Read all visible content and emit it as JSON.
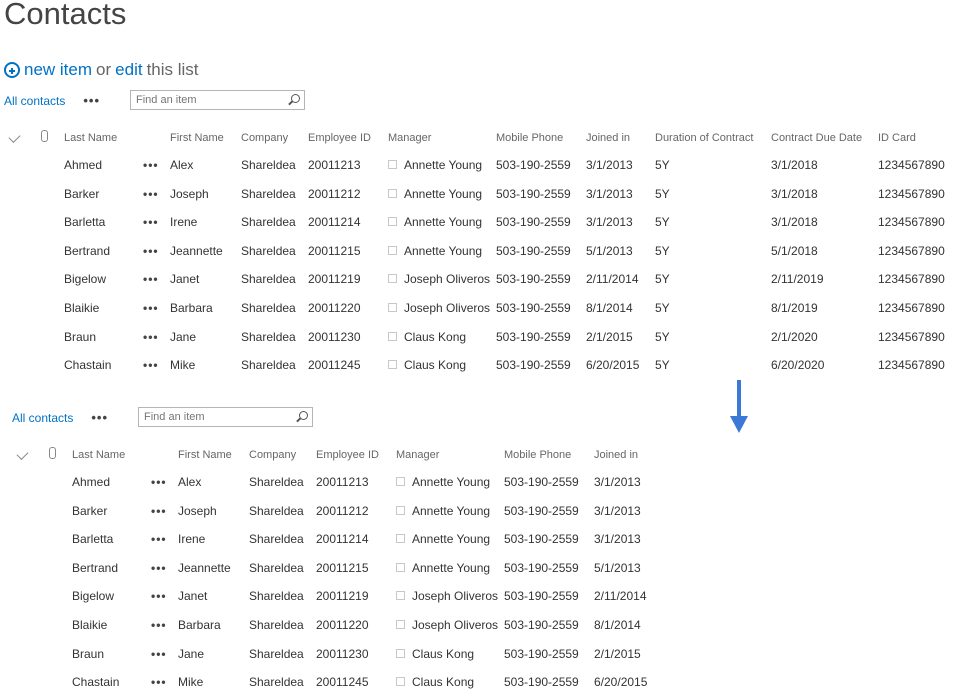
{
  "page_title": "Contacts",
  "new_item": {
    "new_label": "new item",
    "or_label": "or",
    "edit_label": "edit",
    "list_label": "this list"
  },
  "arrow": {
    "color": "#3c79d6"
  },
  "views": [
    {
      "view_name": "All contacts",
      "more_label": "•••",
      "search_placeholder": "Find an item",
      "headers": [
        "Last Name",
        "First Name",
        "Company",
        "Employee ID",
        "Manager",
        "Mobile Phone",
        "Joined in",
        "Duration of Contract",
        "Contract Due Date",
        "ID Card"
      ],
      "rows": [
        {
          "last": "Ahmed",
          "dots": "•••",
          "first": "Alex",
          "company": "Shareldea",
          "emp_id": "20011213",
          "manager": "Annette Young",
          "phone": "503-190-2559",
          "joined": "3/1/2013",
          "duration": "5Y",
          "due": "3/1/2018",
          "id_card": "1234567890"
        },
        {
          "last": "Barker",
          "dots": "•••",
          "first": "Joseph",
          "company": "Shareldea",
          "emp_id": "20011212",
          "manager": "Annette Young",
          "phone": "503-190-2559",
          "joined": "3/1/2013",
          "duration": "5Y",
          "due": "3/1/2018",
          "id_card": "1234567890"
        },
        {
          "last": "Barletta",
          "dots": "•••",
          "first": "Irene",
          "company": "Shareldea",
          "emp_id": "20011214",
          "manager": "Annette Young",
          "phone": "503-190-2559",
          "joined": "3/1/2013",
          "duration": "5Y",
          "due": "3/1/2018",
          "id_card": "1234567890"
        },
        {
          "last": "Bertrand",
          "dots": "•••",
          "first": "Jeannette",
          "company": "Shareldea",
          "emp_id": "20011215",
          "manager": "Annette Young",
          "phone": "503-190-2559",
          "joined": "5/1/2013",
          "duration": "5Y",
          "due": "5/1/2018",
          "id_card": "1234567890"
        },
        {
          "last": "Bigelow",
          "dots": "•••",
          "first": "Janet",
          "company": "Shareldea",
          "emp_id": "20011219",
          "manager": "Joseph Oliveros",
          "phone": "503-190-2559",
          "joined": "2/11/2014",
          "duration": "5Y",
          "due": "2/11/2019",
          "id_card": "1234567890"
        },
        {
          "last": "Blaikie",
          "dots": "•••",
          "first": "Barbara",
          "company": "Shareldea",
          "emp_id": "20011220",
          "manager": "Joseph Oliveros",
          "phone": "503-190-2559",
          "joined": "8/1/2014",
          "duration": "5Y",
          "due": "8/1/2019",
          "id_card": "1234567890"
        },
        {
          "last": "Braun",
          "dots": "•••",
          "first": "Jane",
          "company": "Shareldea",
          "emp_id": "20011230",
          "manager": "Claus Kong",
          "phone": "503-190-2559",
          "joined": "2/1/2015",
          "duration": "5Y",
          "due": "2/1/2020",
          "id_card": "1234567890"
        },
        {
          "last": "Chastain",
          "dots": "•••",
          "first": "Mike",
          "company": "Shareldea",
          "emp_id": "20011245",
          "manager": "Claus Kong",
          "phone": "503-190-2559",
          "joined": "6/20/2015",
          "duration": "5Y",
          "due": "6/20/2020",
          "id_card": "1234567890"
        }
      ]
    },
    {
      "view_name": "All contacts",
      "more_label": "•••",
      "search_placeholder": "Find an item",
      "headers": [
        "Last Name",
        "First Name",
        "Company",
        "Employee ID",
        "Manager",
        "Mobile Phone",
        "Joined in"
      ],
      "rows": [
        {
          "last": "Ahmed",
          "dots": "•••",
          "first": "Alex",
          "company": "Shareldea",
          "emp_id": "20011213",
          "manager": "Annette Young",
          "phone": "503-190-2559",
          "joined": "3/1/2013"
        },
        {
          "last": "Barker",
          "dots": "•••",
          "first": "Joseph",
          "company": "Shareldea",
          "emp_id": "20011212",
          "manager": "Annette Young",
          "phone": "503-190-2559",
          "joined": "3/1/2013"
        },
        {
          "last": "Barletta",
          "dots": "•••",
          "first": "Irene",
          "company": "Shareldea",
          "emp_id": "20011214",
          "manager": "Annette Young",
          "phone": "503-190-2559",
          "joined": "3/1/2013"
        },
        {
          "last": "Bertrand",
          "dots": "•••",
          "first": "Jeannette",
          "company": "Shareldea",
          "emp_id": "20011215",
          "manager": "Annette Young",
          "phone": "503-190-2559",
          "joined": "5/1/2013"
        },
        {
          "last": "Bigelow",
          "dots": "•••",
          "first": "Janet",
          "company": "Shareldea",
          "emp_id": "20011219",
          "manager": "Joseph Oliveros",
          "phone": "503-190-2559",
          "joined": "2/11/2014"
        },
        {
          "last": "Blaikie",
          "dots": "•••",
          "first": "Barbara",
          "company": "Shareldea",
          "emp_id": "20011220",
          "manager": "Joseph Oliveros",
          "phone": "503-190-2559",
          "joined": "8/1/2014"
        },
        {
          "last": "Braun",
          "dots": "•••",
          "first": "Jane",
          "company": "Shareldea",
          "emp_id": "20011230",
          "manager": "Claus Kong",
          "phone": "503-190-2559",
          "joined": "2/1/2015"
        },
        {
          "last": "Chastain",
          "dots": "•••",
          "first": "Mike",
          "company": "Shareldea",
          "emp_id": "20011245",
          "manager": "Claus Kong",
          "phone": "503-190-2559",
          "joined": "6/20/2015"
        }
      ]
    }
  ]
}
